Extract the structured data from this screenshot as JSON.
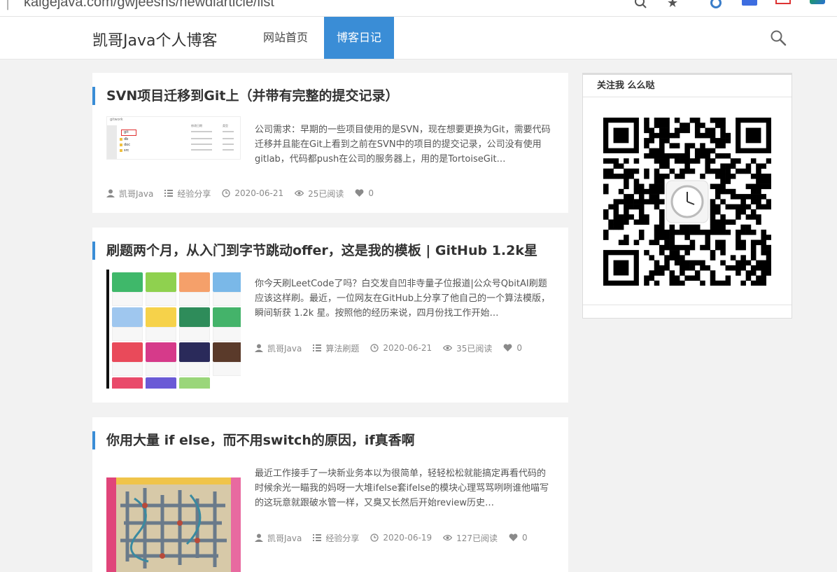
{
  "browser": {
    "url": "kaigejava.com/gwjeesns/newdiarticle/list"
  },
  "header": {
    "site_title": "凯哥Java个人博客",
    "nav": [
      {
        "label": "网站首页",
        "active": false
      },
      {
        "label": "博客日记",
        "active": true
      }
    ]
  },
  "articles": [
    {
      "title": "SVN项目迁移到Git上（并带有完整的提交记录）",
      "summary": "公司需求：早期的一些项目使用的是SVN，现在想要更换为Git，需要代码迁移并且能在Git上看到之前在SVN中的项目的提交记录，公司没有使用gitlab，代码都push在公司的服务器上，用的是TortoiseGit…",
      "author": "凯哥Java",
      "category": "经验分享",
      "date": "2020-06-21",
      "views": "25已阅读",
      "likes": "0",
      "thumb_labels": {
        "breadcrumb": "gitwork",
        "col_date": "修改日期",
        "col_type": "类型",
        "folders": [
          "git",
          "db",
          "doc",
          "src"
        ]
      }
    },
    {
      "title": "刷题两个月，从入门到字节跳动offer，这是我的模板 | GitHub 1.2k星",
      "summary": "你今天刷LeetCode了吗？白交发自凹非寺量子位报道|公众号QbitAI刷题应该这样刷。最近，一位网友在GitHub上分享了他自己的一个算法模版，瞬间斩获 1.2k 星。按照他的经历来说，四月份找工作开始…",
      "author": "凯哥Java",
      "category": "算法刷题",
      "date": "2020-06-21",
      "views": "35已阅读",
      "likes": "0"
    },
    {
      "title": "你用大量 if else，而不用switch的原因，if真香啊",
      "summary": "最近工作接手了一块新业务本以为很简单，轻轻松松就能搞定再看代码的时候余光一瞄我的妈呀一大堆ifelse套ifelse的模块心理骂骂咧咧谁他喵写的这玩意就跟破水管一样，又臭又长然后开始review历史…",
      "author": "凯哥Java",
      "category": "经验分享",
      "date": "2020-06-19",
      "views": "127已阅读",
      "likes": "0"
    }
  ],
  "sidebar": {
    "widget_title": "关注我 么么哒"
  },
  "colors": {
    "accent": "#3a8dd6",
    "page_bg": "#f2f2f2",
    "meta_text": "#8a8a8a"
  }
}
